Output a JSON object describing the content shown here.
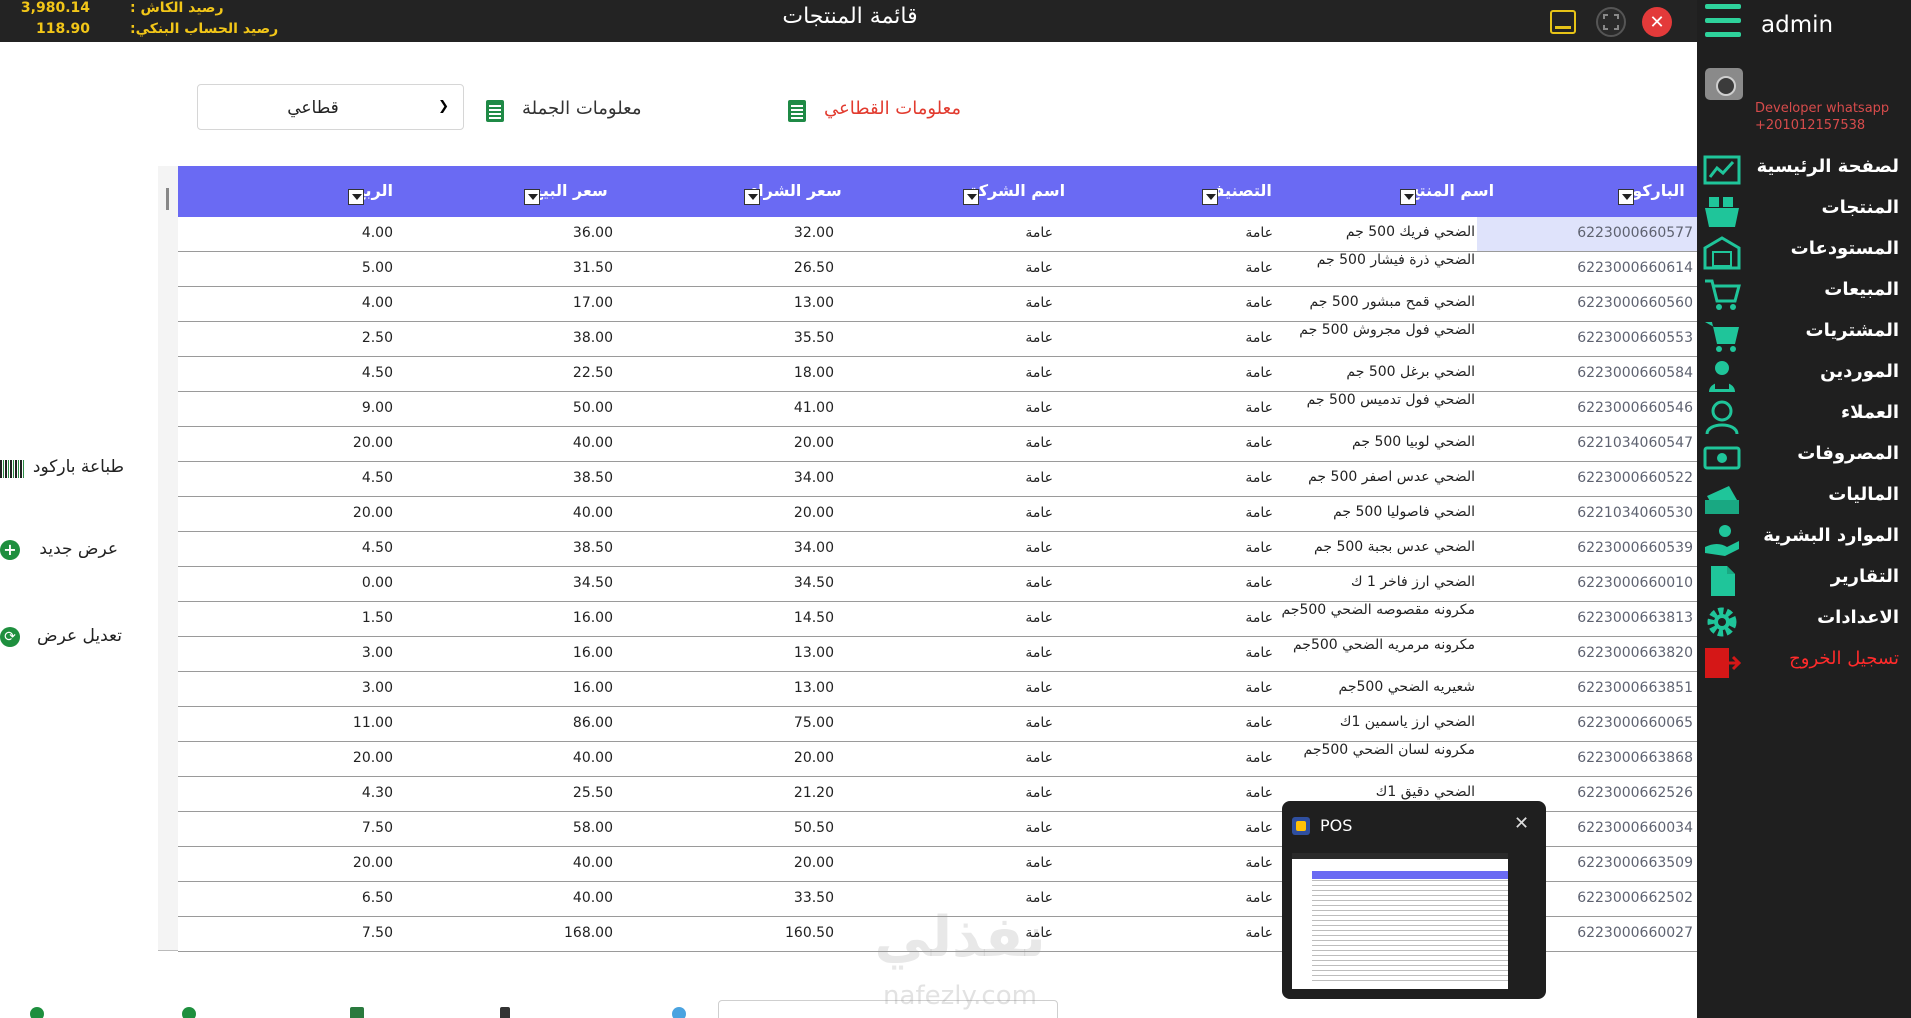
{
  "topbar": {
    "cash_label": "رصيد الكاش :",
    "cash_value": "3,980.14",
    "bank_label": "رصيد الحساب البنكي:",
    "bank_value": "118.90",
    "title": "قائمة المنتجات",
    "close_glyph": "✕"
  },
  "sidebar": {
    "user": "admin",
    "developer": "Developer whatsapp",
    "developer_phone": "+201012157538",
    "items": [
      {
        "label": "لصفحة الرئيسية",
        "icon": "chart-icon"
      },
      {
        "label": "المنتجات",
        "icon": "basket-icon"
      },
      {
        "label": "المستودعات",
        "icon": "warehouse-icon"
      },
      {
        "label": "المبيعات",
        "icon": "cart-icon"
      },
      {
        "label": "المشتريات",
        "icon": "purchase-cart-icon"
      },
      {
        "label": "الموردين",
        "icon": "supplier-icon"
      },
      {
        "label": "العملاء",
        "icon": "customer-icon"
      },
      {
        "label": "المصروفات",
        "icon": "money-icon"
      },
      {
        "label": "الماليات",
        "icon": "cash-stack-icon"
      },
      {
        "label": "الموارد البشرية",
        "icon": "hr-hand-icon"
      },
      {
        "label": "التقارير",
        "icon": "report-icon"
      },
      {
        "label": "الاعدادات",
        "icon": "gear-icon"
      },
      {
        "label": "تسجيل الخروج",
        "icon": "logout-icon"
      }
    ]
  },
  "filters": {
    "select_value": "قطاعي",
    "wholesale_label": "معلومات الجملة",
    "retail_label": "معلومات القطاعي"
  },
  "table": {
    "headers": {
      "barcode": "الباركود",
      "name": "اسم المنتج",
      "category": "التصنيف",
      "company": "اسم الشركة",
      "buy_price": "سعر الشراء",
      "sell_price": "سعر البيع",
      "profit": "الربح"
    },
    "rows": [
      {
        "barcode": "6223000660577",
        "name": "الضحي  فريك 500 جم",
        "category": "عامة",
        "company": "عامة",
        "buy": "32.00",
        "sell": "36.00",
        "profit": "4.00"
      },
      {
        "barcode": "6223000660614",
        "name": "الضحي  ذرة فيشار 500 جم",
        "category": "عامة",
        "company": "عامة",
        "buy": "26.50",
        "sell": "31.50",
        "profit": "5.00"
      },
      {
        "barcode": "6223000660560",
        "name": "الضحي قمح مبشور 500 جم",
        "category": "عامة",
        "company": "عامة",
        "buy": "13.00",
        "sell": "17.00",
        "profit": "4.00"
      },
      {
        "barcode": "6223000660553",
        "name": "الضحي  فول مجروش 500 جم",
        "category": "عامة",
        "company": "عامة",
        "buy": "35.50",
        "sell": "38.00",
        "profit": "2.50"
      },
      {
        "barcode": "6223000660584",
        "name": "الضحي  برغل 500 جم",
        "category": "عامة",
        "company": "عامة",
        "buy": "18.00",
        "sell": "22.50",
        "profit": "4.50"
      },
      {
        "barcode": "6223000660546",
        "name": "الضحي  فول تدميس 500 جم",
        "category": "عامة",
        "company": "عامة",
        "buy": "41.00",
        "sell": "50.00",
        "profit": "9.00"
      },
      {
        "barcode": "6221034060547",
        "name": "الضحي  لوبيا 500 جم",
        "category": "عامة",
        "company": "عامة",
        "buy": "20.00",
        "sell": "40.00",
        "profit": "20.00"
      },
      {
        "barcode": "6223000660522",
        "name": "الضحي  عدس اصفر 500 جم",
        "category": "عامة",
        "company": "عامة",
        "buy": "34.00",
        "sell": "38.50",
        "profit": "4.50"
      },
      {
        "barcode": "6221034060530",
        "name": "الضحي  فاصوليا 500 جم",
        "category": "عامة",
        "company": "عامة",
        "buy": "20.00",
        "sell": "40.00",
        "profit": "20.00"
      },
      {
        "barcode": "6223000660539",
        "name": "الضحي  عدس بجبة 500 جم",
        "category": "عامة",
        "company": "عامة",
        "buy": "34.00",
        "sell": "38.50",
        "profit": "4.50"
      },
      {
        "barcode": "6223000660010",
        "name": "الضحي ارز فاخر 1 ك",
        "category": "عامة",
        "company": "عامة",
        "buy": "34.50",
        "sell": "34.50",
        "profit": "0.00"
      },
      {
        "barcode": "6223000663813",
        "name": "مكرونه مقصوصه الضحي 500جم",
        "category": "عامة",
        "company": "عامة",
        "buy": "14.50",
        "sell": "16.00",
        "profit": "1.50"
      },
      {
        "barcode": "6223000663820",
        "name": "مكرونه مرمريه الضحي 500جم",
        "category": "عامة",
        "company": "عامة",
        "buy": "13.00",
        "sell": "16.00",
        "profit": "3.00"
      },
      {
        "barcode": "6223000663851",
        "name": "شعيريه  الضحي 500جم",
        "category": "عامة",
        "company": "عامة",
        "buy": "13.00",
        "sell": "16.00",
        "profit": "3.00"
      },
      {
        "barcode": "6223000660065",
        "name": "الضحي ارز ياسمين 1ك",
        "category": "عامة",
        "company": "عامة",
        "buy": "75.00",
        "sell": "86.00",
        "profit": "11.00"
      },
      {
        "barcode": "6223000663868",
        "name": "مكرونه لسان الضحي 500جم",
        "category": "عامة",
        "company": "عامة",
        "buy": "20.00",
        "sell": "40.00",
        "profit": "20.00"
      },
      {
        "barcode": "6223000662526",
        "name": "الضحي دقيق 1ك",
        "category": "عامة",
        "company": "عامة",
        "buy": "21.20",
        "sell": "25.50",
        "profit": "4.30"
      },
      {
        "barcode": "6223000660034",
        "name": "",
        "category": "عامة",
        "company": "عامة",
        "buy": "50.50",
        "sell": "58.00",
        "profit": "7.50"
      },
      {
        "barcode": "6223000663509",
        "name": "",
        "category": "عامة",
        "company": "عامة",
        "buy": "20.00",
        "sell": "40.00",
        "profit": "20.00"
      },
      {
        "barcode": "6223000662502",
        "name": "",
        "category": "عامة",
        "company": "عامة",
        "buy": "33.50",
        "sell": "40.00",
        "profit": "6.50"
      },
      {
        "barcode": "6223000660027",
        "name": "",
        "category": "عامة",
        "company": "عامة",
        "buy": "160.50",
        "sell": "168.00",
        "profit": "7.50"
      }
    ]
  },
  "actions": {
    "print_barcode": "طباعة باركود",
    "new_offer": "عرض جديد",
    "edit_offer": "تعديل عرض",
    "plus_glyph": "+",
    "refresh_glyph": "⟳"
  },
  "watermark": {
    "arabic": "نفذلي",
    "latin": "nafezly.com"
  },
  "preview": {
    "title": "POS",
    "close_glyph": "✕"
  },
  "colors": {
    "topbar_bg": "#232323",
    "sidebar_bg": "#1f1f1f",
    "accent_green": "#1fc59a",
    "header_blue": "#6a6af3",
    "balance_yellow": "#f2c618",
    "logout_red": "#ff2b2b"
  }
}
